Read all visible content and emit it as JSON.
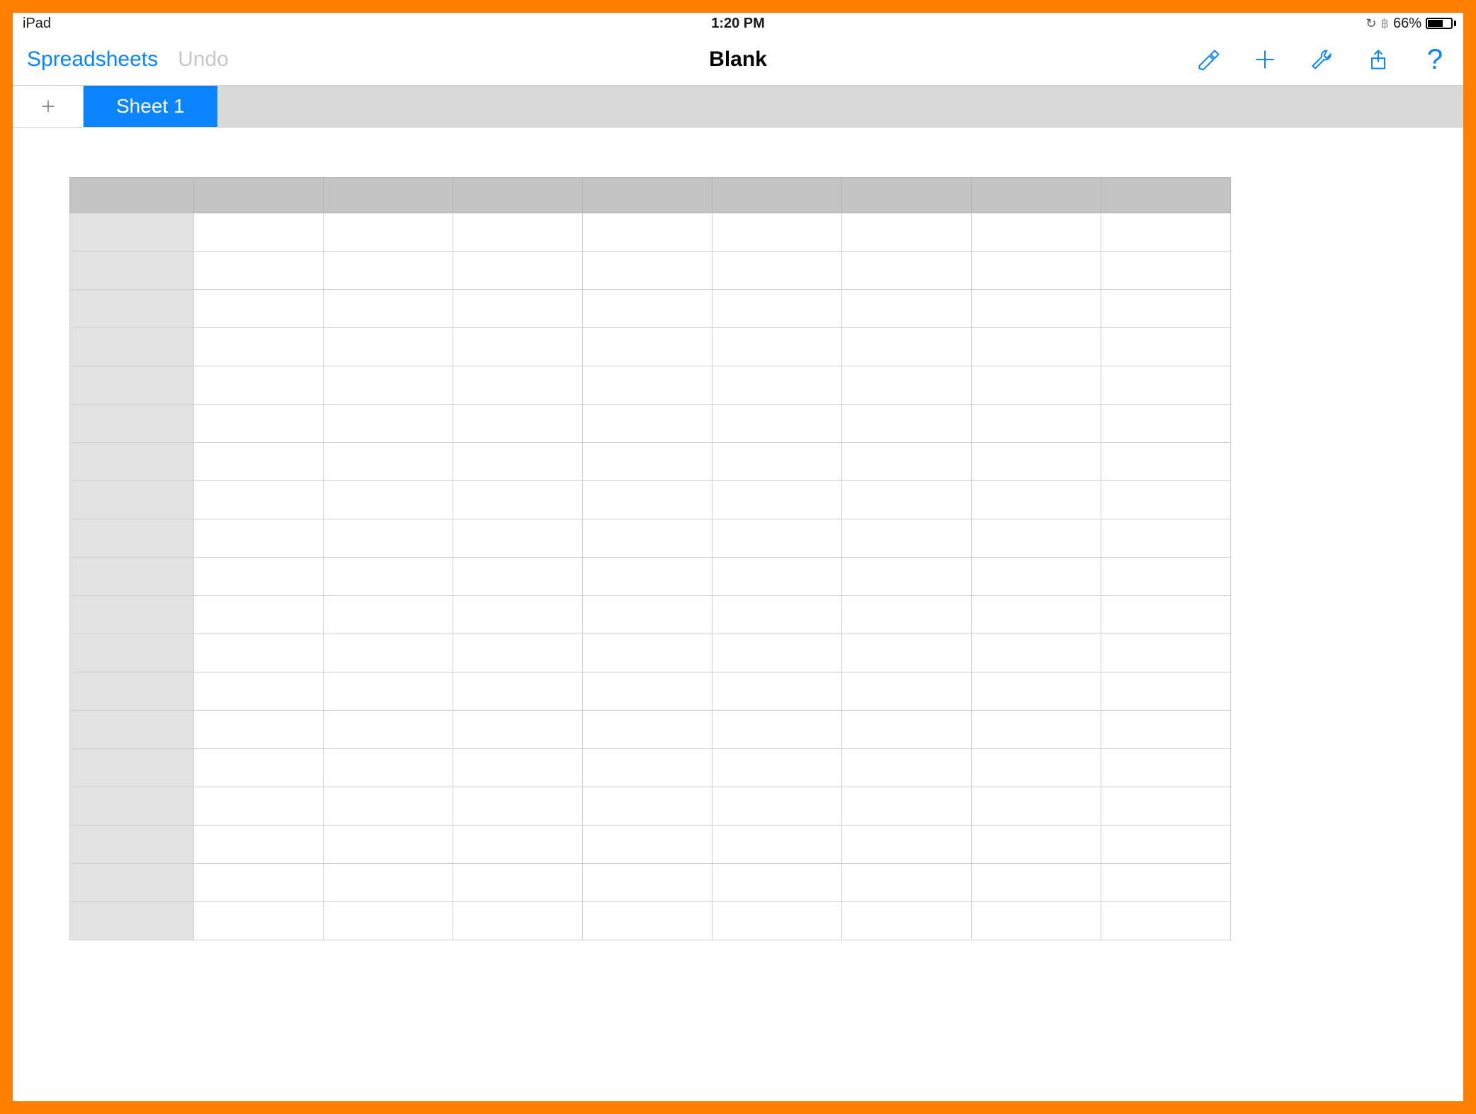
{
  "status": {
    "device": "iPad",
    "time": "1:20 PM",
    "battery_pct": "66%"
  },
  "toolbar": {
    "back_label": "Spreadsheets",
    "undo_label": "Undo",
    "title": "Blank"
  },
  "tabs": {
    "active": "Sheet 1"
  },
  "grid": {
    "columns": 8,
    "rows": 19
  },
  "colors": {
    "accent": "#0a84ff",
    "frame": "#ff7f00",
    "tabbar": "#d9d9d9",
    "header_cell": "#c4c4c4",
    "row_header": "#e3e3e3"
  },
  "icons": {
    "format_brush": "format-brush-icon",
    "plus": "plus-icon",
    "wrench": "wrench-icon",
    "share": "share-icon",
    "help": "help-icon",
    "add_sheet": "plus-icon",
    "orientation_lock": "orientation-lock-icon",
    "bluetooth": "bluetooth-icon",
    "battery": "battery-icon"
  }
}
